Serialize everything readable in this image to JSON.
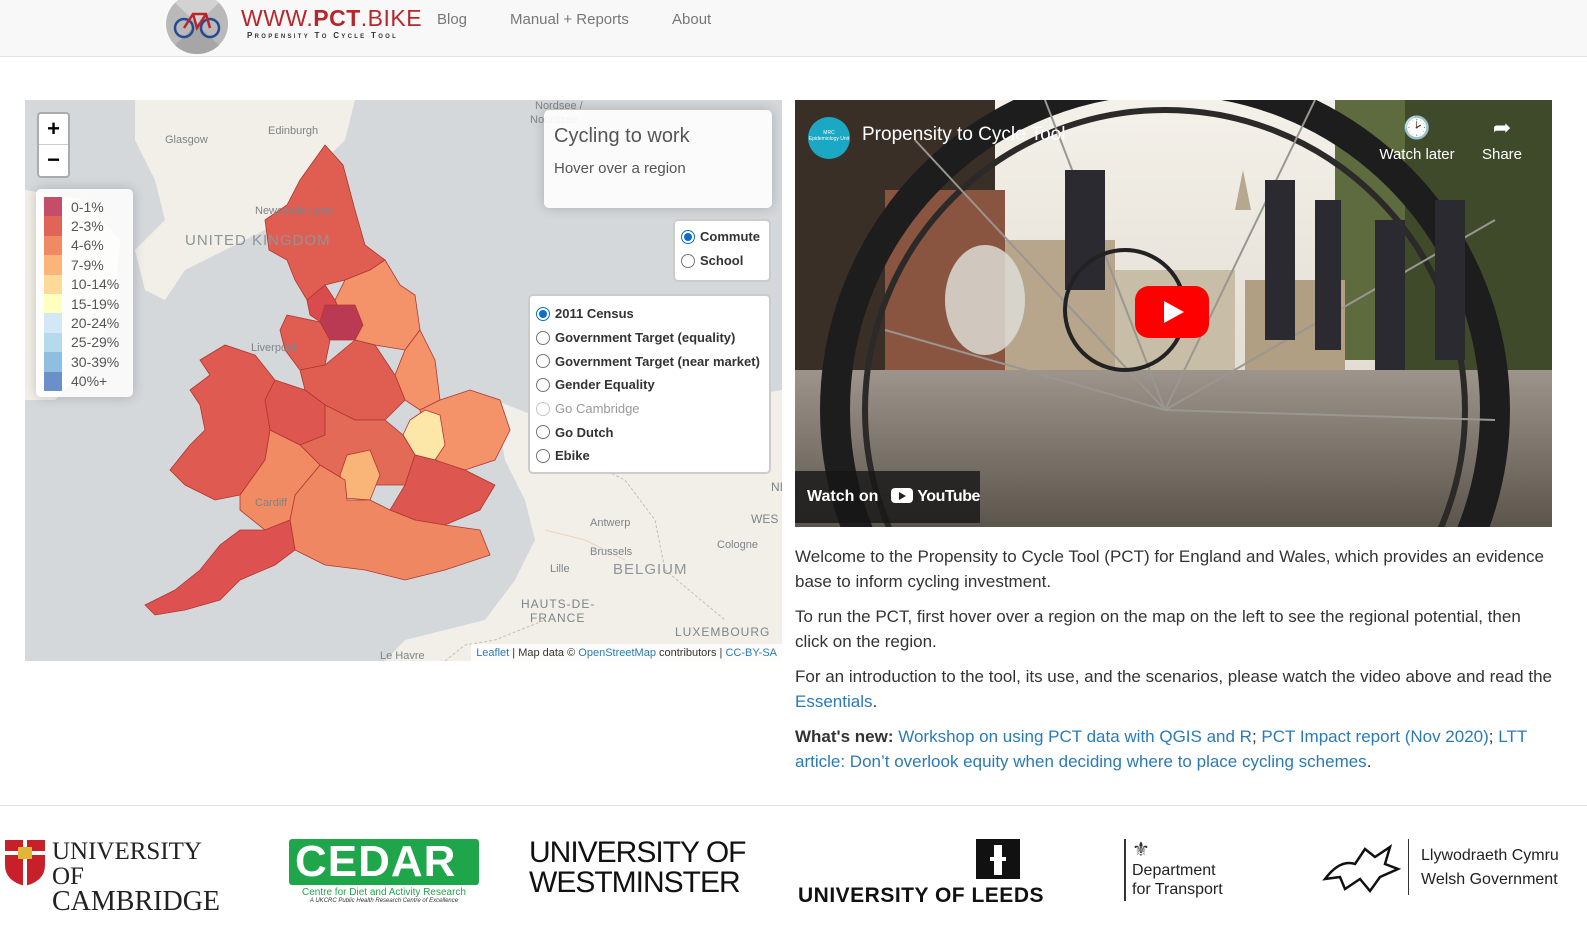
{
  "navbar": {
    "logo_prefix": "WWW.",
    "logo_bold": "PCT",
    "logo_suffix": ".BIKE",
    "logo_tagline": "Propensity To Cycle Tool",
    "links": [
      "Blog",
      "Manual + Reports",
      "About"
    ]
  },
  "map": {
    "zoom_in": "+",
    "zoom_out": "−",
    "place_labels": {
      "nordsee": "Nordsee /",
      "nordsee2": "Noordzee",
      "edinburgh": "Edinburgh",
      "glasgow": "Glasgow",
      "newcastle": "Newcastle upon",
      "uk": "UNITED KINGDOM",
      "liverpool": "Liverpool",
      "cardiff": "Cardiff",
      "antwerp": "Antwerp",
      "brussels": "Brussels",
      "cologne": "Cologne",
      "lille": "Lille",
      "belgium": "BELGIUM",
      "hauts": "HAUTS-DE-",
      "france": "FRANCE",
      "luxembourg": "LUXEMBOURG",
      "lehavre": "Le Havre",
      "wes": "WES",
      "ni": "NI"
    },
    "legend": [
      {
        "label": "0-1%",
        "color": "#c44e6a"
      },
      {
        "label": "2-3%",
        "color": "#e06458"
      },
      {
        "label": "4-6%",
        "color": "#ef8a62"
      },
      {
        "label": "7-9%",
        "color": "#fbb57a"
      },
      {
        "label": "10-14%",
        "color": "#fdd99a"
      },
      {
        "label": "15-19%",
        "color": "#ffffbf"
      },
      {
        "label": "20-24%",
        "color": "#d4e7f4"
      },
      {
        "label": "25-29%",
        "color": "#b7d9ec"
      },
      {
        "label": "30-39%",
        "color": "#90bee0"
      },
      {
        "label": "40%+",
        "color": "#6a8fc9"
      }
    ],
    "info": {
      "title": "Cycling to work",
      "subtitle": "Hover over a region"
    },
    "purpose_options": [
      {
        "label": "Commute",
        "selected": true
      },
      {
        "label": "School",
        "selected": false
      }
    ],
    "scenario_options": [
      {
        "label": "2011 Census",
        "selected": true,
        "disabled": false
      },
      {
        "label": "Government Target (equality)",
        "selected": false,
        "disabled": false
      },
      {
        "label": "Government Target (near market)",
        "selected": false,
        "disabled": false
      },
      {
        "label": "Gender Equality",
        "selected": false,
        "disabled": false
      },
      {
        "label": "Go Cambridge",
        "selected": false,
        "disabled": true
      },
      {
        "label": "Go Dutch",
        "selected": false,
        "disabled": false
      },
      {
        "label": "Ebike",
        "selected": false,
        "disabled": false
      }
    ],
    "attribution": {
      "leaflet": "Leaflet",
      "sep1": " | Map data © ",
      "osm": "OpenStreetMap",
      "contributors": " contributors | ",
      "license": "CC-BY-SA"
    }
  },
  "video": {
    "title": "Propensity to Cycle Tool",
    "channel_badge": "MRC Epidemiology Unit",
    "watch_later": "Watch later",
    "share": "Share",
    "watch_on": "Watch on",
    "youtube": "YouTube"
  },
  "intro": {
    "p1": "Welcome to the Propensity to Cycle Tool (PCT) for England and Wales, which provides an evidence base to inform cycling investment.",
    "p2": "To run the PCT, first hover over a region on the map on the left to see the regional potential, then click on the region.",
    "p3_before": "For an introduction to the tool, its use, and the scenarios, please watch the video above and read the ",
    "p3_link": "Essentials",
    "p3_after": ".",
    "whats_new_label": "What's new:",
    "news_1": "Workshop on using PCT data with QGIS and R",
    "sep_1": "; ",
    "news_2": "PCT Impact report (Nov 2020)",
    "sep_2": "; ",
    "news_3": "LTT article: Don’t overlook equity when deciding where to place cycling schemes",
    "news_end": "."
  },
  "footer": {
    "cambridge_line1": "UNIVERSITY OF",
    "cambridge_line2": "CAMBRIDGE",
    "cedar_name": "CEDAR",
    "cedar_line1": "Centre for Diet and Activity Research",
    "cedar_line2": "A UKCRC Public Health Research Centre of Excellence",
    "westminster_line1": "UNIVERSITY OF",
    "westminster_line2": "WESTMINSTER",
    "leeds": "UNIVERSITY OF LEEDS",
    "dft_line1": "Department",
    "dft_line2": "for Transport",
    "welsh_line1": "Llywodraeth Cymru",
    "welsh_line2": "Welsh Government"
  }
}
